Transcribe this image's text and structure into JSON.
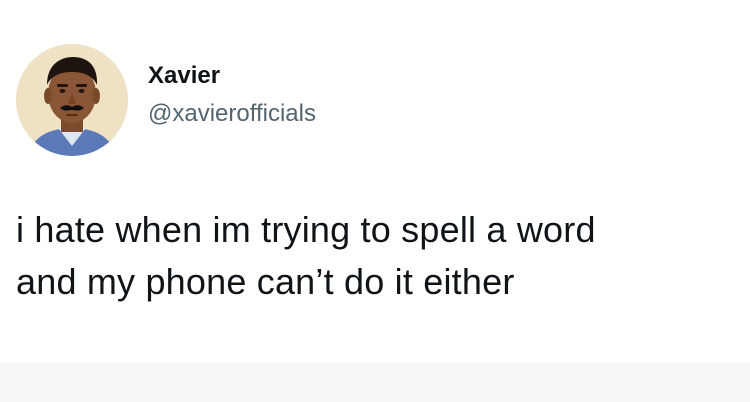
{
  "author": {
    "display_name": "Xavier",
    "handle": "@xavierofficials",
    "avatar": "profile-photo"
  },
  "tweet": {
    "text_line_1": "i hate when im trying to spell a word",
    "text_line_2": "and my phone can’t do it either"
  }
}
